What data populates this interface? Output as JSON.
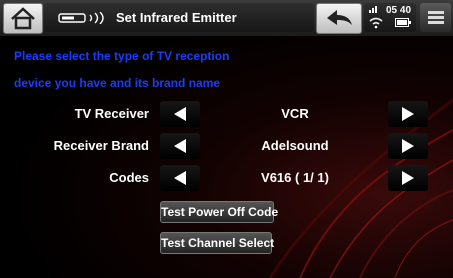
{
  "header": {
    "title": "Set Infrared Emitter",
    "clock": "05 40"
  },
  "instructions": {
    "line1": "Please select the type of TV reception",
    "line2": "device you have and its brand name"
  },
  "settings": [
    {
      "label": "TV Receiver",
      "value": "VCR"
    },
    {
      "label": "Receiver Brand",
      "value": "Adelsound"
    },
    {
      "label": "Codes",
      "value": "V616 ( 1/ 1)"
    }
  ],
  "actions": {
    "test_power": "Test Power Off Code",
    "test_channel": "Test Channel Select"
  },
  "colors": {
    "instruction_text": "#1a3cff",
    "background_glow": "#3a0a0a"
  }
}
